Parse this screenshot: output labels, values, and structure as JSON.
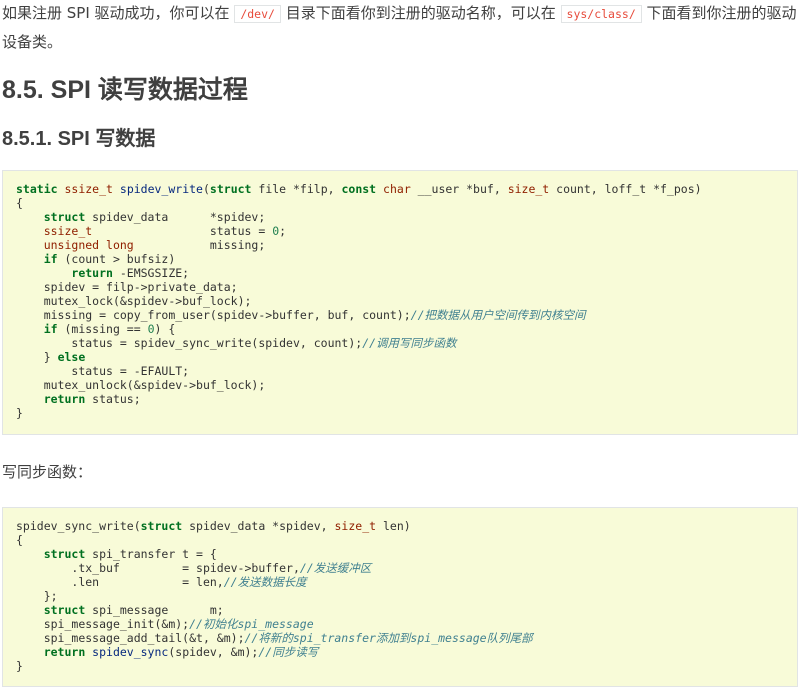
{
  "intro": {
    "part1": "如果注册 SPI 驱动成功，你可以在",
    "code1": "/dev/",
    "part2": "目录下面看你到注册的驱动名称，可以在",
    "code2": "sys/class/",
    "part3": "下面看到你注册的驱动设备类。"
  },
  "section": {
    "heading": "8.5. SPI 读写数据过程",
    "subheading": "8.5.1. SPI 写数据"
  },
  "write_code": {
    "l1": {
      "kw1": "static",
      "t1": "ssize_t",
      "fn": "spidev_write",
      "p1": "(",
      "kw2": "struct",
      "p2": " file *filp, ",
      "kw3": "const",
      "t2": "char",
      "p3": " __user *buf, ",
      "t3": "size_t",
      "p4": " count, loff_t *f_pos)"
    },
    "l2": "{",
    "l3": {
      "kw": "struct",
      "rest": " spidev_data      *spidev;"
    },
    "l4": {
      "ty": "ssize_t",
      "rest": "                 status = ",
      "num": "0",
      "end": ";"
    },
    "l5": {
      "ty": "unsigned long",
      "rest": "           missing;"
    },
    "l6": {
      "kw": "if",
      "rest": " (count > bufsiz)"
    },
    "l7": {
      "kw": "return",
      "rest": " -EMSGSIZE;"
    },
    "l8": "spidev = filp->private_data;",
    "l9": "mutex_lock(&spidev->buf_lock);",
    "l10": {
      "code": "missing = copy_from_user(spidev->buffer, buf, count);",
      "comment": "//把数据从用户空间传到内核空间"
    },
    "l11": {
      "kw": "if",
      "rest": " (missing == ",
      "num": "0",
      "end": ") {"
    },
    "l12": {
      "code": "status = spidev_sync_write(spidev, count);",
      "comment": "//调用写同步函数"
    },
    "l13": {
      "pre": "} ",
      "kw": "else"
    },
    "l14": "status = -EFAULT;",
    "l15": "mutex_unlock(&spidev->buf_lock);",
    "l16": {
      "kw": "return",
      "rest": " status;"
    },
    "l17": "}"
  },
  "sync_intro": "写同步函数：",
  "sync_code": {
    "l1": {
      "pre": "spidev_sync_write(",
      "kw": "struct",
      "mid": " spidev_data *spidev, ",
      "ty": "size_t",
      "end": " len)"
    },
    "l2": "{",
    "l3": {
      "kw": "struct",
      "rest": " spi_transfer t = {"
    },
    "l4": {
      "code": ".tx_buf         = spidev->buffer,",
      "comment": "//发送缓冲区"
    },
    "l5": {
      "code": ".len            = len,",
      "comment": "//发送数据长度"
    },
    "l6": "};",
    "l7": {
      "kw": "struct",
      "rest": " spi_message      m;"
    },
    "l8": {
      "code": "spi_message_init(&m);",
      "comment": "//初始化spi_message"
    },
    "l9": {
      "code": "spi_message_add_tail(&t, &m);",
      "comment": "//将新的spi_transfer添加到spi_message队列尾部"
    },
    "l10": {
      "kw": "return",
      "fn": " spidev_sync",
      "rest": "(spidev, &m);",
      "comment": "//同步读写"
    },
    "l11": "}"
  },
  "colors": {
    "text": "#404040",
    "inline_code": "#e74c3c",
    "code_bg": "#f8fbd8",
    "keyword": "#007020",
    "type": "#902000",
    "function": "#06287e",
    "number": "#208050",
    "comment": "#408090"
  }
}
